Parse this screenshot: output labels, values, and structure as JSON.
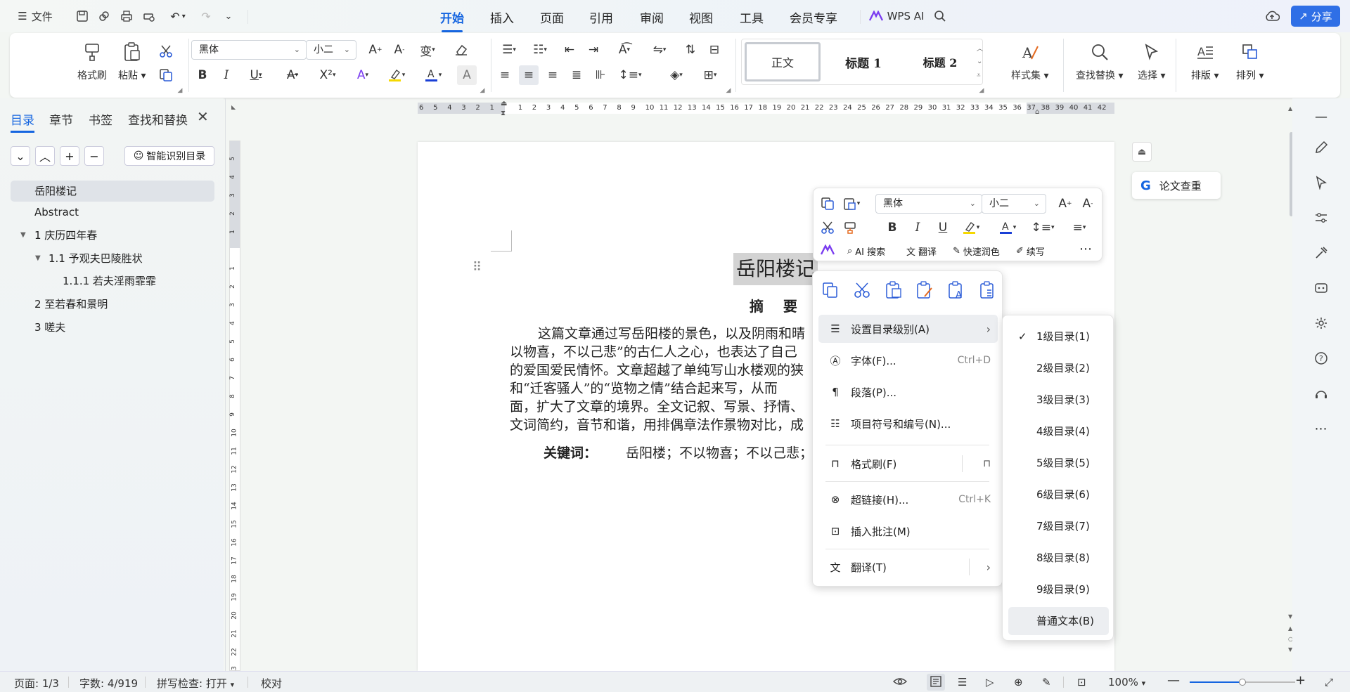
{
  "topbar": {
    "file_menu": "文件",
    "tabs": [
      "开始",
      "插入",
      "页面",
      "引用",
      "审阅",
      "视图",
      "工具",
      "会员专享"
    ],
    "active_tab": "开始",
    "wps_ai": "WPS AI",
    "share": "分享"
  },
  "ribbon": {
    "format_painter": "格式刷",
    "paste": "粘贴",
    "font_name": "黑体",
    "font_size": "小二",
    "styles": [
      "正文",
      "标题 1",
      "标题 2"
    ],
    "style_set": "样式集",
    "find_replace": "查找替换",
    "select": "选择",
    "layout": "排版",
    "arrange": "排列"
  },
  "left_panel": {
    "tabs": [
      "目录",
      "章节",
      "书签",
      "查找和替换"
    ],
    "smart_toc": "智能识别目录",
    "toc_items": [
      {
        "label": "岳阳楼记"
      },
      {
        "label": "Abstract"
      },
      {
        "label": "1 庆历四年春"
      },
      {
        "label": "1.1 予观夫巴陵胜状"
      },
      {
        "label": "1.1.1 若夫淫雨霏霏"
      },
      {
        "label": "2 至若春和景明"
      },
      {
        "label": "3 嗟夫"
      }
    ]
  },
  "ruler": {
    "h_ticks": [
      "6",
      "5",
      "4",
      "3",
      "2",
      "1",
      "",
      "1",
      "2",
      "3",
      "4",
      "5",
      "6",
      "7",
      "8",
      "9",
      "10",
      "11",
      "12",
      "13",
      "14",
      "15",
      "16",
      "17",
      "18",
      "19",
      "20",
      "21",
      "22",
      "23",
      "24",
      "25",
      "26",
      "27",
      "28",
      "29",
      "30",
      "31",
      "32",
      "33",
      "34",
      "35",
      "36",
      "37",
      "38",
      "39",
      "40",
      "41",
      "42"
    ],
    "v_ticks": [
      "5",
      "4",
      "3",
      "2",
      "1",
      "",
      "1",
      "2",
      "3",
      "4",
      "5",
      "6",
      "7",
      "8",
      "9",
      "10",
      "11",
      "12",
      "13",
      "14",
      "15",
      "16",
      "17",
      "18",
      "19",
      "20",
      "21",
      "22",
      "23"
    ]
  },
  "document": {
    "title": "岳阳楼记",
    "abstract_heading": "摘    要",
    "lines": [
      "这篇文章通过写岳阳楼的景色，以及阴雨和晴",
      "以物喜，不以己悲”的古仁人之心，也表达了自己",
      "的爱国爱民情怀。文章超越了单纯写山水楼观的狭",
      "和“迁客骚人”的“览物之情”结合起来写，从而",
      "面，扩大了文章的境界。全文记叙、写景、抒情、",
      "文词简约，音节和谐，用排偶章法作景物对比，成"
    ],
    "keywords_label": "关键词：",
    "keywords_value": "岳阳楼；不以物喜；不以己悲；",
    "plagiarism_check": "论文查重"
  },
  "mini_toolbar": {
    "font_name": "黑体",
    "font_size": "小二",
    "ai_search": "AI 搜索",
    "translate": "翻译",
    "polish": "快速润色",
    "continue": "续写"
  },
  "context_menu": {
    "items": [
      {
        "label": "设置目录级别(A)",
        "shortcut": ""
      },
      {
        "label": "字体(F)...",
        "shortcut": "Ctrl+D"
      },
      {
        "label": "段落(P)...",
        "shortcut": ""
      },
      {
        "label": "项目符号和编号(N)...",
        "shortcut": ""
      },
      {
        "label": "格式刷(F)",
        "shortcut": ""
      },
      {
        "label": "超链接(H)...",
        "shortcut": "Ctrl+K"
      },
      {
        "label": "插入批注(M)",
        "shortcut": ""
      },
      {
        "label": "翻译(T)",
        "shortcut": ""
      }
    ]
  },
  "submenu": {
    "items": [
      "1级目录(1)",
      "2级目录(2)",
      "3级目录(3)",
      "4级目录(4)",
      "5级目录(5)",
      "6级目录(6)",
      "7级目录(7)",
      "8级目录(8)",
      "9级目录(9)",
      "普通文本(B)"
    ],
    "checked_index": 0
  },
  "status_bar": {
    "page": "页面: 1/3",
    "words": "字数: 4/919",
    "spell": "拼写检查: 打开",
    "proof": "校对",
    "zoom": "100%",
    "zoom_level": 0.5
  },
  "colors": {
    "accent": "#1565e0",
    "highlight": "#f5d800",
    "font_color": "#1a3fd6"
  }
}
